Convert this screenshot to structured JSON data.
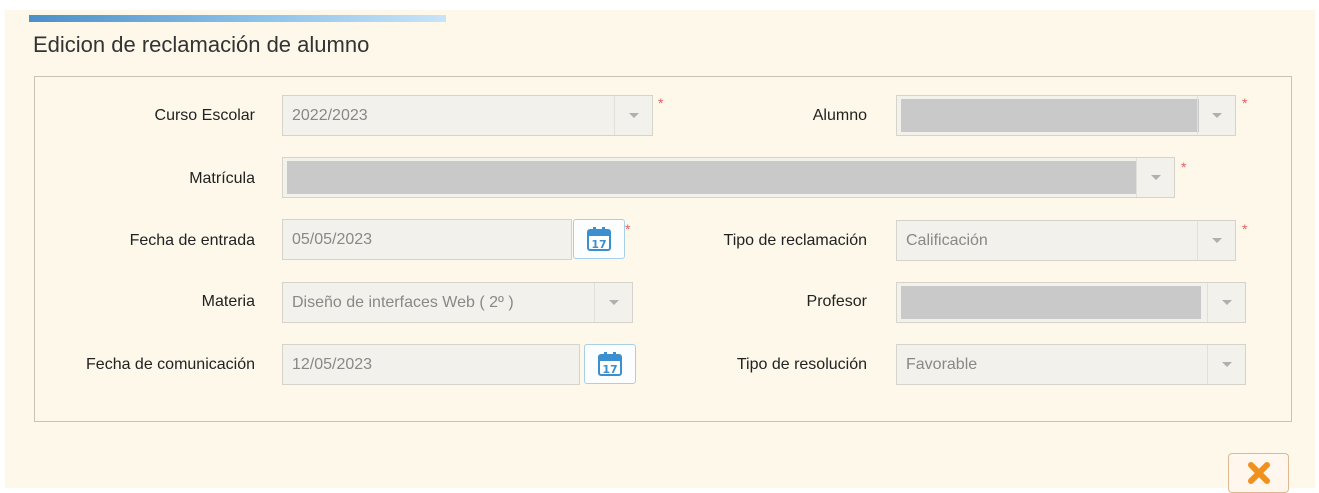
{
  "form": {
    "title": "Edicion de reclamación de alumno",
    "required_mark": "*"
  },
  "fields": {
    "curso_escolar": {
      "label": "Curso Escolar",
      "value": "2022/2023"
    },
    "alumno": {
      "label": "Alumno",
      "value": ""
    },
    "matricula": {
      "label": "Matrícula",
      "value": ""
    },
    "fecha_entrada": {
      "label": "Fecha de entrada",
      "value": "05/05/2023"
    },
    "tipo_reclamacion": {
      "label": "Tipo de reclamación",
      "value": "Calificación"
    },
    "materia": {
      "label": "Materia",
      "value": "Diseño de interfaces Web  ( 2º )"
    },
    "profesor": {
      "label": "Profesor",
      "value": ""
    },
    "fecha_comunicacion": {
      "label": "Fecha de comunicación",
      "value": "12/05/2023"
    },
    "tipo_resolucion": {
      "label": "Tipo de resolución",
      "value": "Favorable"
    }
  },
  "icons": {
    "calendar": "calendar-icon",
    "calendar_day": "17",
    "close": "close-icon",
    "dropdown": "chevron-down-icon"
  },
  "colors": {
    "panel_background": "#fdf8ea",
    "accent": "#4a90c8",
    "required": "#e06060",
    "close_icon": "#f0901e",
    "redacted": "#c9c9c9"
  }
}
